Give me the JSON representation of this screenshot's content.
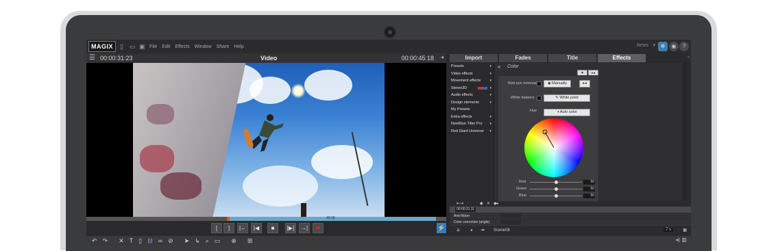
{
  "app": {
    "logo": "MAGIX",
    "menu": [
      "File",
      "Edit",
      "Effects",
      "Window",
      "Share",
      "Help"
    ],
    "news_label": "News"
  },
  "player": {
    "timecode_left": "00:00:31:23",
    "title": "Video",
    "timecode_right": "00:00:45:18",
    "scrub_label": "45:18",
    "progress_fraction": 0.58
  },
  "tabs": [
    "Import",
    "Fades",
    "Title",
    "Effects"
  ],
  "active_tab": "Effects",
  "effects_list": [
    "Presets",
    "Video effects",
    "Movement effects",
    "Stereo3D",
    "Audio effects",
    "Design elements",
    "My Presets",
    "Extra effects",
    "NewBlue Titler Pro",
    "Red Giant Universe"
  ],
  "color_panel": {
    "title": "Color",
    "red_eye_label": "Red eye removal",
    "manually_btn": "Manually",
    "white_balance_label": "White balance",
    "white_point_btn": "White point",
    "hue_label": "Hue",
    "auto_color_btn": "Auto color",
    "sliders": [
      {
        "label": "Red",
        "value": "50"
      },
      {
        "label": "Green",
        "value": "50"
      },
      {
        "label": "Blue",
        "value": "50"
      }
    ]
  },
  "timeline": {
    "timecode": "00:00:31:11",
    "tracks": [
      "Anti-flicker",
      "Color correction (angle)"
    ],
    "scene_label": "Scene08",
    "zoom_label": "7 s"
  },
  "colors": {
    "accent": "#2e7fc2",
    "record": "#e02020"
  }
}
